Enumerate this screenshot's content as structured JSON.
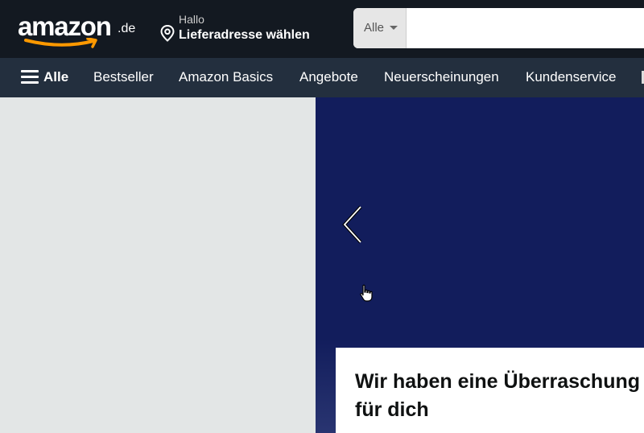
{
  "header": {
    "logo_text": "amazon",
    "logo_tld": ".de",
    "deliver_greeting": "Hallo",
    "deliver_address": "Lieferadresse wählen",
    "search_category": "Alle",
    "search_placeholder": ""
  },
  "nav": {
    "all_label": "Alle",
    "items": [
      "Bestseller",
      "Amazon Basics",
      "Angebote",
      "Neuerscheinungen",
      "Kundenservice"
    ]
  },
  "hero": {
    "card_title": "Wir haben eine Überraschung für dich"
  },
  "icons": {
    "menu": "hamburger-icon",
    "location": "location-pin-icon",
    "caret": "caret-down-icon",
    "prev": "chevron-left-icon",
    "cursor": "hand-pointer-icon"
  },
  "colors": {
    "topbar": "#131921",
    "navbar": "#232f3e",
    "hero": "#121d5c",
    "smile": "#ff9900",
    "page": "#e3e6e6"
  }
}
